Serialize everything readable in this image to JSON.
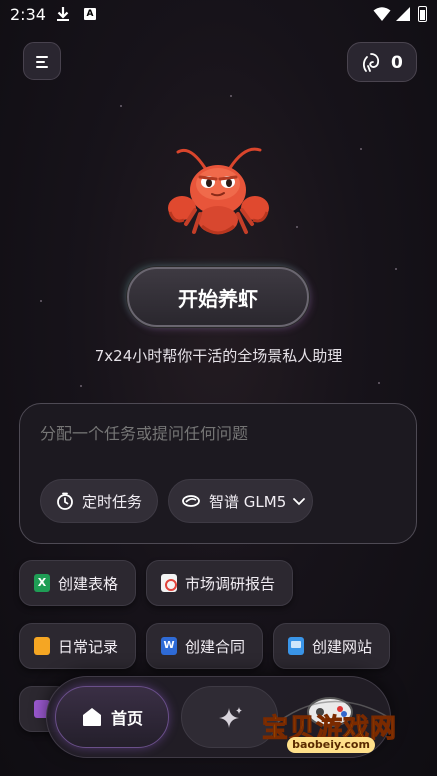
{
  "status_bar": {
    "time": "2:34",
    "a_badge": "A",
    "icons": [
      "download-icon",
      "a-badge-icon",
      "wifi-icon",
      "signal-icon",
      "battery-icon"
    ]
  },
  "header": {
    "menu_icon": "menu-icon",
    "credits_icon": "token-icon",
    "credits_count": "0"
  },
  "hero": {
    "mascot": "lobster-mascot",
    "start_label": "开始养虾",
    "tagline": "7x24小时帮你干活的全场景私人助理"
  },
  "composer": {
    "placeholder": "分配一个任务或提问任何问题",
    "timer_label": "定时任务",
    "timer_icon": "clock-icon",
    "model_label": "智谱 GLM5",
    "model_icon": "model-logo-icon",
    "model_dropdown_icon": "chevron-down-icon"
  },
  "quick_actions": {
    "create_sheet": "创建表格",
    "market_report": "市场调研报告",
    "daily_log": "日常记录",
    "create_contract": "创建合同",
    "create_website": "创建网站"
  },
  "bottom_nav": {
    "home_label": "首页",
    "home_icon": "home-icon",
    "sparkle_icon": "sparkle-icon"
  },
  "watermark": {
    "text": "宝贝游戏网",
    "url": "baobeiy.com"
  },
  "colors": {
    "background": "#17131a",
    "accent_purple": "#6a4f8a",
    "accent_teal": "#78dcc8",
    "watermark_gold": "#f5b800"
  }
}
